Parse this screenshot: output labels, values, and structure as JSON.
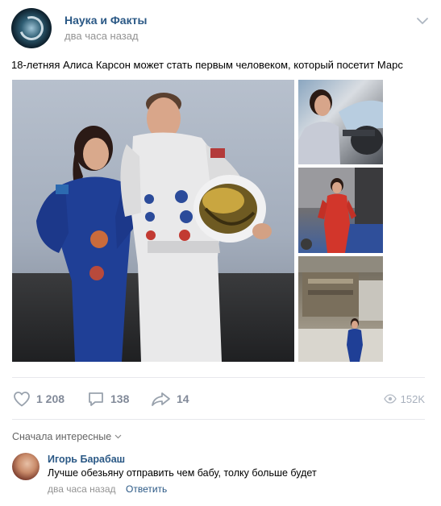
{
  "post": {
    "group_name": "Наука и Факты",
    "time": "два часа назад",
    "text": "18-летняя Алиса Карсон может стать первым человеком, который посетит Марс"
  },
  "photos": {
    "main_alt": "photo-main",
    "side_count": 3
  },
  "actions": {
    "likes": "1 208",
    "comments": "138",
    "shares": "14",
    "views": "152K"
  },
  "comments_section": {
    "sort_label": "Сначала интересные"
  },
  "comment": {
    "author": "Игорь Барабаш",
    "text": "Лучше обезьяну отправить чем бабу, толку больше будет",
    "time": "два часа назад",
    "reply_label": "Ответить"
  },
  "colors": {
    "link": "#2a5885",
    "muted": "#939393",
    "action": "#828a99"
  }
}
